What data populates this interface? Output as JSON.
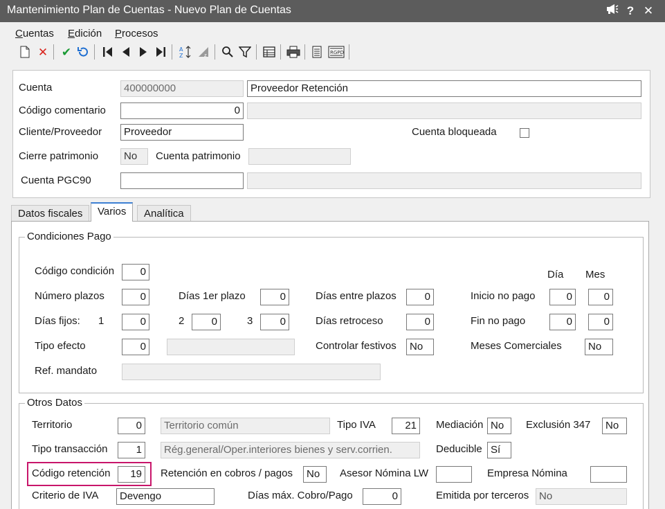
{
  "window": {
    "title": "Mantenimiento Plan de Cuentas - Nuevo Plan de Cuentas"
  },
  "menu": {
    "cuentas": {
      "mnemonic": "C",
      "rest": "uentas"
    },
    "edicion": {
      "mnemonic": "E",
      "rest": "dición"
    },
    "procesos": {
      "mnemonic": "P",
      "rest": "rocesos"
    }
  },
  "header": {
    "cuenta_label": "Cuenta",
    "cuenta_value": "400000000",
    "cuenta_name": "Proveedor Retención",
    "codigo_comentario_label": "Código comentario",
    "codigo_comentario_value": "0",
    "codigo_comentario_desc": "",
    "cliente_proveedor_label": "Cliente/Proveedor",
    "cliente_proveedor_value": "Proveedor",
    "cuenta_bloqueada_label": "Cuenta bloqueada",
    "cierre_patrimonio_label": "Cierre patrimonio",
    "cierre_patrimonio_value": "No",
    "cuenta_patrimonio_label": "Cuenta patrimonio",
    "cuenta_patrimonio_value": "",
    "cuenta_pgc90_label": "Cuenta PGC90",
    "cuenta_pgc90_value": "",
    "cuenta_pgc90_desc": ""
  },
  "tabs": [
    "Datos fiscales",
    "Varios",
    "Analítica"
  ],
  "condiciones_pago": {
    "title": "Condiciones Pago",
    "dia_header": "Día",
    "mes_header": "Mes",
    "codigo_condicion_label": "Código condición",
    "codigo_condicion_value": "0",
    "numero_plazos_label": "Número plazos",
    "numero_plazos_value": "0",
    "dias_1er_plazo_label": "Días 1er plazo",
    "dias_1er_plazo_value": "0",
    "dias_entre_plazos_label": "Días entre plazos",
    "dias_entre_plazos_value": "0",
    "inicio_no_pago_label": "Inicio no pago",
    "inicio_no_pago_dia": "0",
    "inicio_no_pago_mes": "0",
    "dias_fijos_label": "Días fijos:",
    "dias_fijos_1_label": "1",
    "dias_fijos_1_value": "0",
    "dias_fijos_2_label": "2",
    "dias_fijos_2_value": "0",
    "dias_fijos_3_label": "3",
    "dias_fijos_3_value": "0",
    "dias_retroceso_label": "Días retroceso",
    "dias_retroceso_value": "0",
    "fin_no_pago_label": "Fin no pago",
    "fin_no_pago_dia": "0",
    "fin_no_pago_mes": "0",
    "tipo_efecto_label": "Tipo efecto",
    "tipo_efecto_value": "0",
    "tipo_efecto_desc": "",
    "controlar_festivos_label": "Controlar festivos",
    "controlar_festivos_value": "No",
    "meses_comerciales_label": "Meses Comerciales",
    "meses_comerciales_value": "No",
    "ref_mandato_label": "Ref. mandato",
    "ref_mandato_value": ""
  },
  "otros_datos": {
    "title": "Otros Datos",
    "territorio_label": "Territorio",
    "territorio_value": "0",
    "territorio_desc": "Territorio común",
    "tipo_iva_label": "Tipo IVA",
    "tipo_iva_value": "21",
    "mediacion_label": "Mediación",
    "mediacion_value": "No",
    "exclusion_347_label": "Exclusión 347",
    "exclusion_347_value": "No",
    "tipo_transaccion_label": "Tipo transacción",
    "tipo_transaccion_value": "1",
    "tipo_transaccion_desc": "Rég.general/Oper.interiores bienes y serv.corrien.",
    "deducible_label": "Deducible",
    "deducible_value": "Sí",
    "codigo_retencion_label": "Código retención",
    "codigo_retencion_value": "19",
    "retencion_cobros_label": "Retención en cobros / pagos",
    "retencion_cobros_value": "No",
    "asesor_nomina_label": "Asesor Nómina LW",
    "asesor_nomina_value": "",
    "empresa_nomina_label": "Empresa Nómina",
    "empresa_nomina_value": "",
    "criterio_iva_label": "Criterio de IVA",
    "criterio_iva_value": "Devengo",
    "dias_max_cobro_label": "Días máx. Cobro/Pago",
    "dias_max_cobro_value": "0",
    "emitida_terceros_label": "Emitida por terceros",
    "emitida_terceros_value": "No"
  },
  "colors": {
    "titlebar": "#5c5c5c",
    "highlight": "#c8156a",
    "accent_blue": "#1f6fd1",
    "accent_green": "#1a9a34",
    "accent_red": "#d9231c"
  }
}
